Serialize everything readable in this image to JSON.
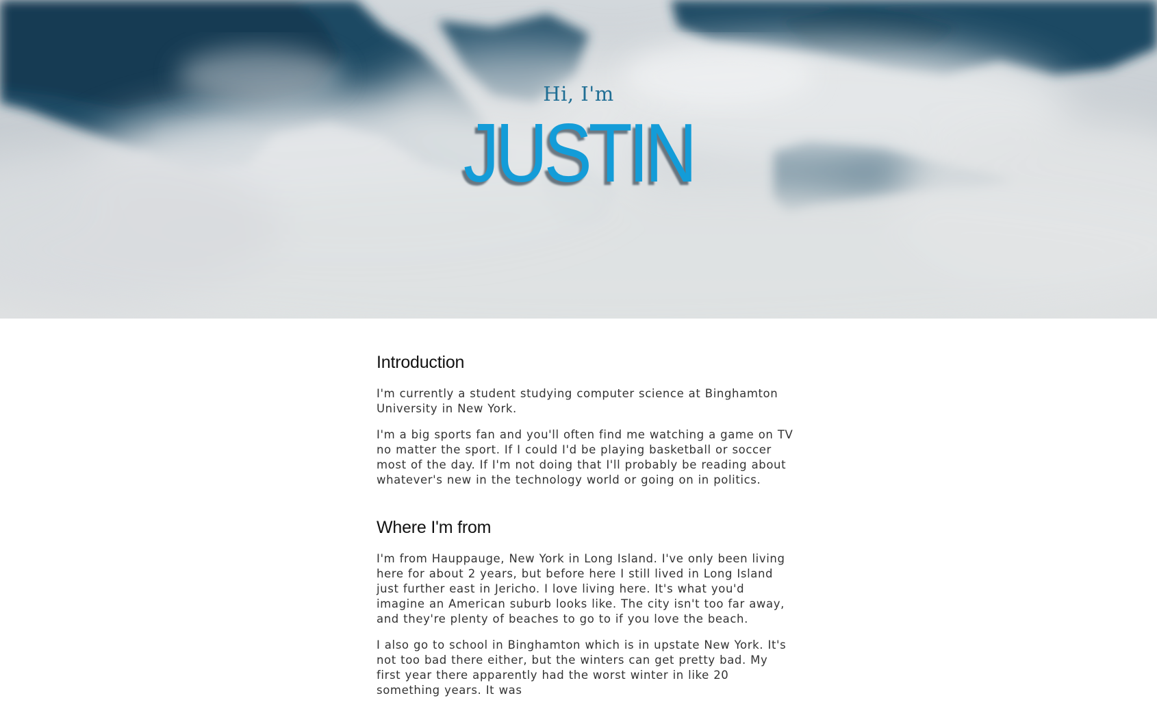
{
  "hero": {
    "greeting": "Hi, I'm",
    "name": "JUSTIN",
    "name_color": "#139cd8",
    "greeting_color": "#1f6e94"
  },
  "sections": [
    {
      "heading": "Introduction",
      "paragraphs": [
        "I'm currently a student studying computer science at Binghamton University in New York.",
        "I'm a big sports fan and you'll often find me watching a game on TV no matter the sport. If I could I'd be playing basketball or soccer most of the day. If I'm not doing that I'll probably be reading about whatever's new in the technology world or going on in politics."
      ]
    },
    {
      "heading": "Where I'm from",
      "paragraphs": [
        "I'm from Hauppauge, New York in Long Island. I've only been living here for about 2 years, but before here I still lived in Long Island just further east in Jericho. I love living here. It's what you'd imagine an American suburb looks like. The city isn't too far away, and they're plenty of beaches to go to if you love the beach.",
        "I also go to school in Binghamton which is in upstate New York. It's not too bad there either, but the winters can get pretty bad. My first year there apparently had the worst winter in like 20 something years. It was"
      ]
    }
  ]
}
